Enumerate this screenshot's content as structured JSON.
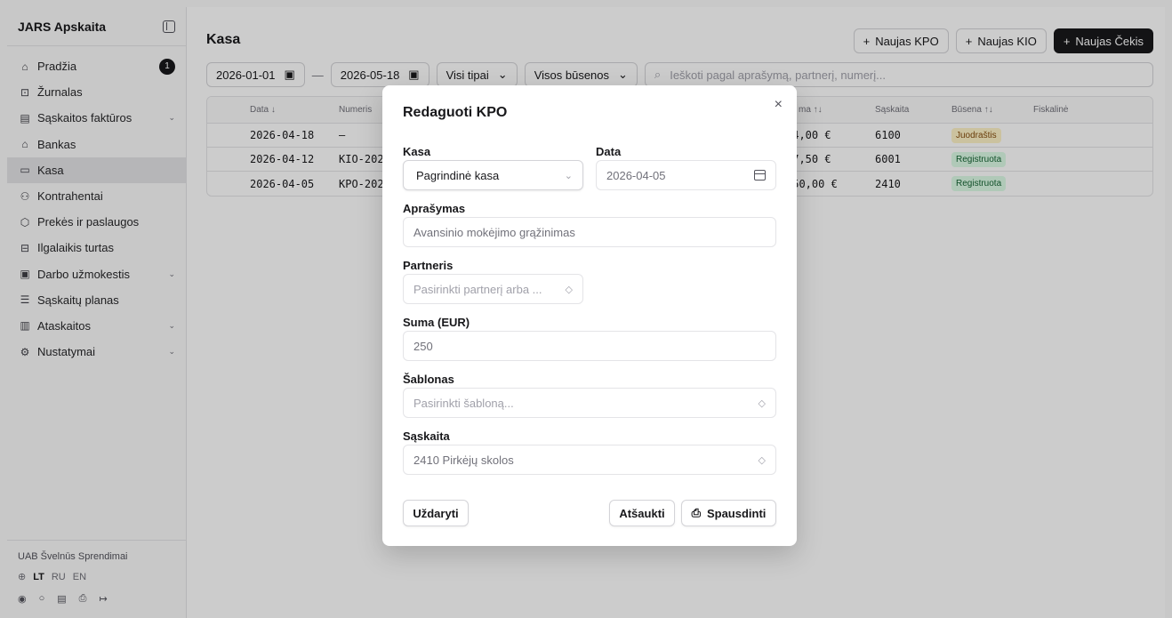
{
  "sidebar": {
    "title": "JARS Apskaita",
    "items": [
      {
        "label": "Pradžia",
        "icon": "home-icon",
        "glyph": "⌂",
        "badge": "1"
      },
      {
        "label": "Žurnalas",
        "icon": "book-icon",
        "glyph": "⊡"
      },
      {
        "label": "Sąskaitos faktūros",
        "icon": "file-icon",
        "glyph": "▤",
        "chevron": "⌄"
      },
      {
        "label": "Bankas",
        "icon": "bank-icon",
        "glyph": "⌂"
      },
      {
        "label": "Kasa",
        "icon": "wallet-icon",
        "glyph": "▭",
        "active": true
      },
      {
        "label": "Kontrahentai",
        "icon": "users-icon",
        "glyph": "⚇"
      },
      {
        "label": "Prekės ir paslaugos",
        "icon": "package-icon",
        "glyph": "⬡"
      },
      {
        "label": "Ilgalaikis turtas",
        "icon": "asset-icon",
        "glyph": "⊟"
      },
      {
        "label": "Darbo užmokestis",
        "icon": "payroll-icon",
        "glyph": "▣",
        "chevron": "⌄"
      },
      {
        "label": "Sąskaitų planas",
        "icon": "list-icon",
        "glyph": "☰"
      },
      {
        "label": "Ataskaitos",
        "icon": "chart-icon",
        "glyph": "▥",
        "chevron": "⌄"
      },
      {
        "label": "Nustatymai",
        "icon": "gear-icon",
        "glyph": "⚙",
        "chevron": "⌄"
      }
    ],
    "company": "UAB Švelnūs Sprendimai",
    "languages": [
      "LT",
      "RU",
      "EN"
    ]
  },
  "main": {
    "title": "Kasa",
    "buttons": {
      "kpo": "Naujas KPO",
      "kio": "Naujas KIO",
      "check": "Naujas Čekis"
    },
    "filters": {
      "date_from": "2026-01-01",
      "date_to": "2026-05-18",
      "type": "Visi tipai",
      "status": "Visos būsenos",
      "search_placeholder": "Ieškoti pagal aprašymą, partnerį, numerį..."
    },
    "table": {
      "headers": {
        "date": "Data ↓",
        "number": "Numeris",
        "sum": "ma ↑↓",
        "account": "Sąskaita",
        "status": "Būsena ↑↓",
        "fiscal": "Fiskalinė"
      },
      "rows": [
        {
          "date": "2026-04-18",
          "number": "–",
          "sum": "54,00 €",
          "account": "6100",
          "status": "Juodraštis",
          "status_kind": "draft"
        },
        {
          "date": "2026-04-12",
          "number": "KIO-202",
          "sum": "87,50 €",
          "account": "6001",
          "status": "Registruota",
          "status_kind": "registered"
        },
        {
          "date": "2026-04-05",
          "number": "KPO-202",
          "sum": "250,00 €",
          "account": "2410",
          "status": "Registruota",
          "status_kind": "registered"
        }
      ]
    }
  },
  "modal": {
    "title": "Redaguoti KPO",
    "close": "×",
    "kasa_label": "Kasa",
    "kasa_value": "Pagrindinė kasa",
    "data_label": "Data",
    "data_value": "2026-04-05",
    "description_label": "Aprašymas",
    "description_value": "Avansinio mokėjimo grąžinimas",
    "partner_label": "Partneris",
    "partner_placeholder": "Pasirinkti partnerį arba ...",
    "sum_label": "Suma (EUR)",
    "sum_value": "250",
    "template_label": "Šablonas",
    "template_placeholder": "Pasirinkti šabloną...",
    "account_label": "Sąskaita",
    "account_value": "2410 Pirkėjų skolos",
    "close_button": "Uždaryti",
    "cancel_button": "Atšaukti",
    "print_button": "Spausdinti"
  },
  "colors": {
    "primary": "#18181b",
    "draft_bg": "#fef3c7",
    "registered_bg": "#dcfce7"
  }
}
